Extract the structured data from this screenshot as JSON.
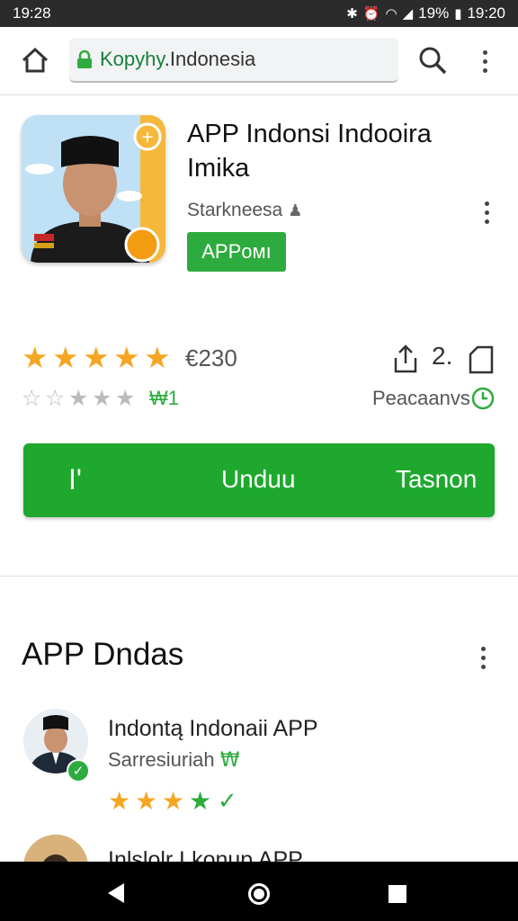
{
  "status_bar": {
    "time_left": "19:28",
    "battery": "19%",
    "time_right": "19:20"
  },
  "browser": {
    "url_prefix": "Kopyhy",
    "url_rest": ".Indonesia"
  },
  "app": {
    "title": "APP Indonsi Indooira Imika",
    "developer": "Starkneesa",
    "badge": "APPoмı",
    "rating_count": "€230",
    "rating_value": 5,
    "secondary_value": "₩1",
    "size": "2.",
    "content_label": "Peacaanvs"
  },
  "action_bar": {
    "left_label": "I'",
    "install_label": "Unduu",
    "right_label": "Tasnon"
  },
  "section": {
    "title": "APP Dndas",
    "items": [
      {
        "title": "Indontą Indonaii APP",
        "subtitle": "Sarresiuriah",
        "subtitle_mark": "₩",
        "rating": 4
      },
      {
        "title": "Inlslolr Lkonup APP"
      }
    ]
  },
  "colors": {
    "accent": "#1fa82e",
    "star": "#f5a623"
  }
}
